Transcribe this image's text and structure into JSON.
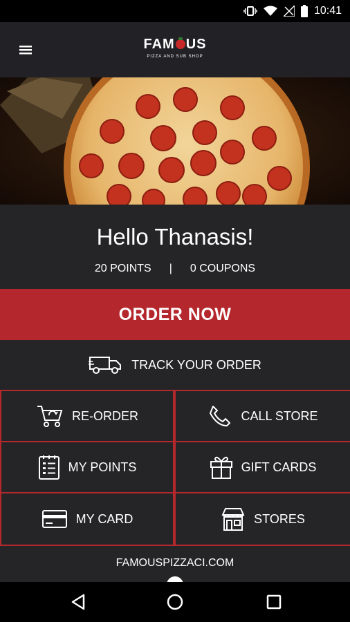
{
  "status_bar": {
    "time": "10:41"
  },
  "app_bar": {
    "logo_text_start": "FAM",
    "logo_text_end": "US",
    "logo_subtitle": "PIZZA AND SUB SHOP"
  },
  "greeting": {
    "title": "Hello Thanasis!",
    "points": "20 POINTS",
    "separator": "|",
    "coupons": "0 COUPONS"
  },
  "order_now_label": "ORDER NOW",
  "track_order_label": "TRACK YOUR ORDER",
  "grid": {
    "reorder": "RE-ORDER",
    "call_store": "CALL STORE",
    "my_points": "MY POINTS",
    "gift_cards": "GIFT CARDS",
    "my_card": "MY CARD",
    "stores": "STORES"
  },
  "footer_link": "FAMOUSPIZZACI.COM",
  "colors": {
    "accent_red": "#b4272c",
    "background": "#252528",
    "app_bar": "#222226"
  }
}
